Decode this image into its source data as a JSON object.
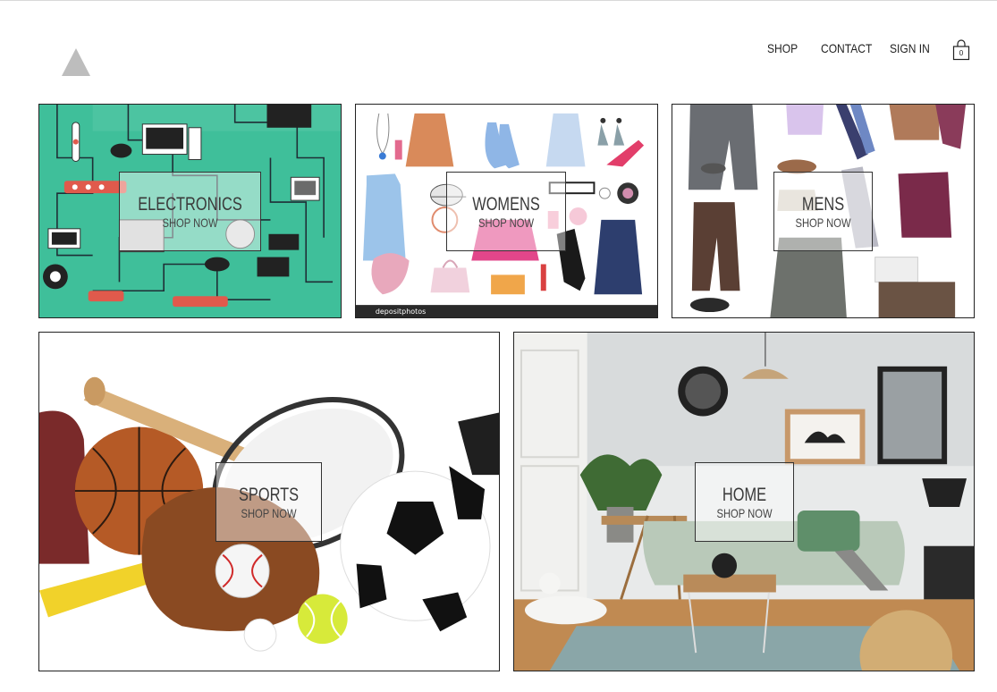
{
  "nav": {
    "shop": "SHOP",
    "contact": "CONTACT",
    "sign_in": "SIGN IN",
    "cart_count": "0"
  },
  "categories": [
    {
      "title": "ELECTRONICS",
      "cta": "SHOP NOW",
      "image": "electronics-photo"
    },
    {
      "title": "WOMENS",
      "cta": "SHOP NOW",
      "image": "womens-fashion-photo",
      "watermark": "depositphotos"
    },
    {
      "title": "MENS",
      "cta": "SHOP NOW",
      "image": "mens-fashion-photo"
    },
    {
      "title": "SPORTS",
      "cta": "SHOP NOW",
      "image": "sports-equipment-photo"
    },
    {
      "title": "HOME",
      "cta": "SHOP NOW",
      "image": "living-room-photo"
    }
  ],
  "colors": {
    "electronics_bg": "#3fbf9a",
    "border": "#222222",
    "logo": "#bdbdbd"
  },
  "icons": [
    "logo-triangle",
    "shopping-bag-icon"
  ]
}
